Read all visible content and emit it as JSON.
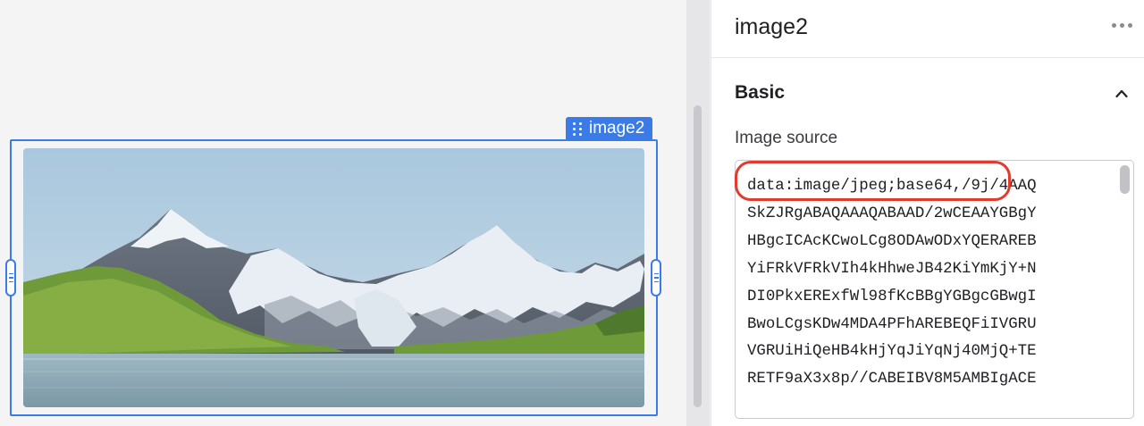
{
  "canvas": {
    "component_tag": "image2",
    "image_alt": "mountain-lake-landscape"
  },
  "panel": {
    "title": "image2",
    "more_icon": "ellipsis-icon",
    "section": {
      "title": "Basic",
      "collapse_icon": "chevron-up-icon"
    },
    "image_source": {
      "label": "Image source",
      "lines": [
        "data:image/jpeg;base64,/9j/4AAQ",
        "SkZJRgABAQAAAQABAAD/2wCEAAYGBgY",
        "HBgcICAcKCwoLCg8ODAwODxYQERAREB",
        "YiFRkVFRkVIh4kHhweJB42KiYmKjY+N",
        "DI0PkxERExfWl98fKcBBgYGBgcGBwgI",
        "BwoLCgsKDw4MDA4PFhAREBEQFiIVGRU",
        "VGRUiHiQeHB4kHjYqJiYqNj40MjQ+TE",
        "RETF9aX3x8p//CABEIBV8M5AMBIgACE"
      ]
    }
  },
  "colors": {
    "accent": "#3b7be8",
    "highlight": "#e23b2e"
  }
}
